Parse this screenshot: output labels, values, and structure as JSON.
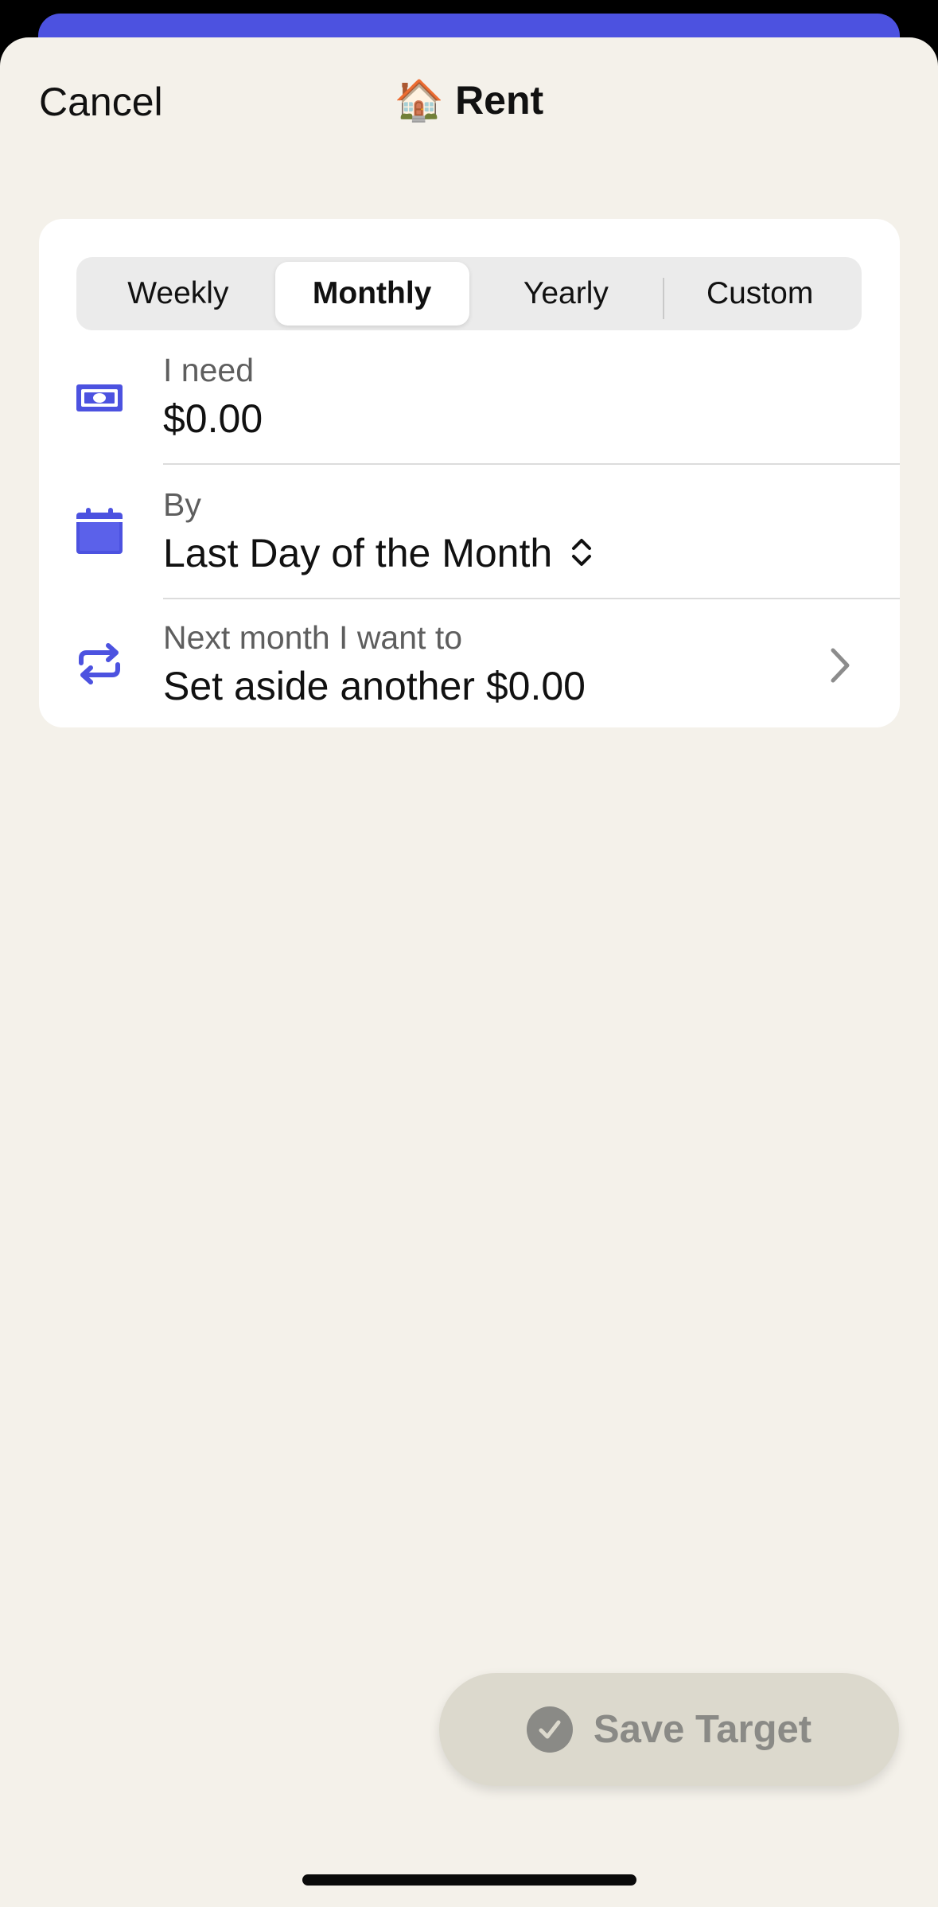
{
  "header": {
    "cancel_label": "Cancel",
    "title_emoji": "🏠",
    "title": "Rent"
  },
  "frequency": {
    "options": [
      "Weekly",
      "Monthly",
      "Yearly",
      "Custom"
    ],
    "selected": "Monthly"
  },
  "need_row": {
    "icon": "money-icon",
    "label": "I need",
    "value": "$0.00"
  },
  "by_row": {
    "icon": "calendar-icon",
    "label": "By",
    "value": "Last Day of the Month"
  },
  "next_row": {
    "icon": "repeat-icon",
    "label": "Next month I want to",
    "value": "Set aside another $0.00"
  },
  "save_button": {
    "label": "Save Target"
  },
  "colors": {
    "accent": "#4c52e0",
    "sheet_background": "#f4f1ea",
    "card_background": "#ffffff",
    "save_button_disabled": "#dcd9cd"
  }
}
